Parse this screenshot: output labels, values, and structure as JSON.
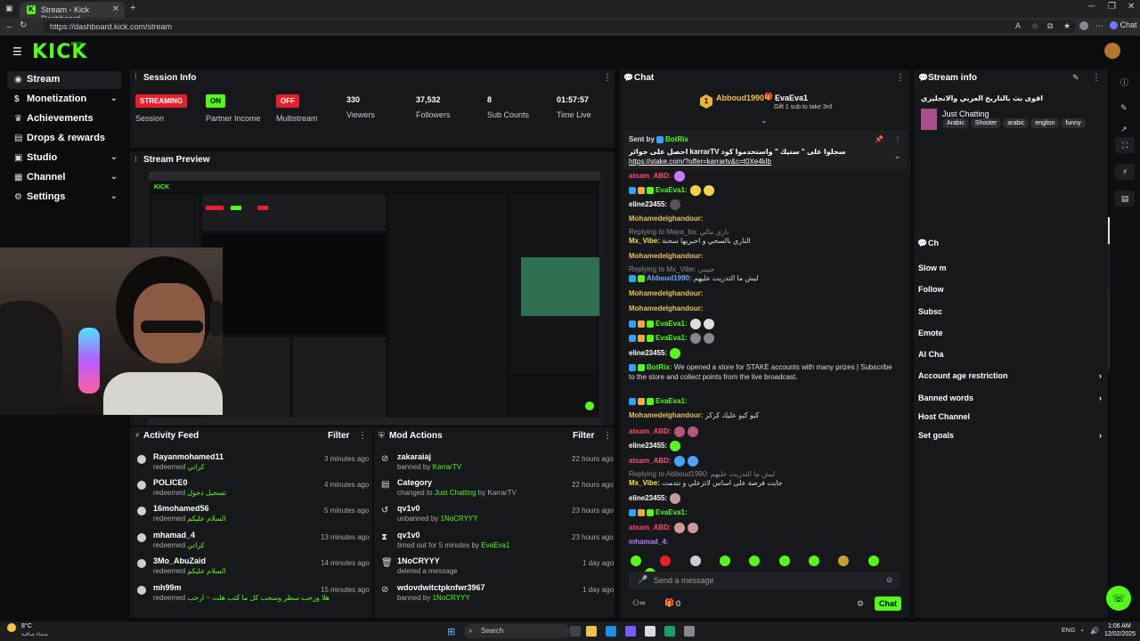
{
  "browser": {
    "tab_title": "Stream - Kick Dashboard",
    "url": "https://dashboard.kick.com/stream",
    "chat_label": "Chat"
  },
  "kick": {
    "logo": "KICK",
    "beta": "BETA"
  },
  "sidebar": {
    "items": [
      {
        "label": "Stream"
      },
      {
        "label": "Monetization"
      },
      {
        "label": "Achievements"
      },
      {
        "label": "Drops & rewards"
      },
      {
        "label": "Studio"
      },
      {
        "label": "Channel"
      },
      {
        "label": "Settings"
      }
    ]
  },
  "session": {
    "title": "Session Info",
    "stats": [
      {
        "value": "STREAMING",
        "label": "Session"
      },
      {
        "value": "ON",
        "label": "Partner Income"
      },
      {
        "value": "OFF",
        "label": "Multistream"
      },
      {
        "value": "330",
        "label": "Viewers"
      },
      {
        "value": "37,532",
        "label": "Followers"
      },
      {
        "value": "8",
        "label": "Sub Counts"
      },
      {
        "value": "01:57:57",
        "label": "Time Live"
      }
    ]
  },
  "preview": {
    "title": "Stream Preview"
  },
  "activity": {
    "title": "Activity Feed",
    "filter": "Filter",
    "rows": [
      {
        "name": "Rayanmohamed11",
        "action": "redeemed",
        "reward": "كراتي",
        "time": "3 minutes ago"
      },
      {
        "name": "POLICE0",
        "action": "redeemed",
        "reward": "تسجيل دخول",
        "time": "4 minutes ago"
      },
      {
        "name": "16mohamed56",
        "action": "redeemed",
        "reward": "السلام عليكم",
        "time": "5 minutes ago"
      },
      {
        "name": "mhamad_4",
        "action": "redeemed",
        "reward": "كراتي",
        "time": "13 minutes ago"
      },
      {
        "name": "3Mo_AbuZaid",
        "action": "redeemed",
        "reward": "السلام عليكم",
        "time": "14 minutes ago"
      },
      {
        "name": "mh99m",
        "action": "redeemed",
        "reward": "هلا ورحب سطر وسحب كل ما كتب هلت ~ ارحب",
        "time": "15 minutes ago"
      }
    ]
  },
  "mod": {
    "title": "Mod Actions",
    "filter": "Filter",
    "rows": [
      {
        "name": "zakaraiaj",
        "desc": "banned by",
        "by": "KarrarTV",
        "time": "22 hours ago"
      },
      {
        "name": "Category",
        "desc": "changed to",
        "by": "Just Chatting",
        "by2": "by KarrarTV",
        "time": "22 hours ago"
      },
      {
        "name": "qv1v0",
        "desc": "unbanned by",
        "by": "1NoCRYYY",
        "time": "23 hours ago"
      },
      {
        "name": "qv1v0",
        "desc": "timed out for 5 minutes by",
        "by": "EvaEva1",
        "time": "23 hours ago"
      },
      {
        "name": "1NoCRYYY",
        "desc": "deleted a message",
        "by": "",
        "time": "1 day ago"
      },
      {
        "name": "wdovdwitctpknfwr3967",
        "desc": "banned by",
        "by": "1NoCRYYY",
        "time": "1 day ago"
      }
    ]
  },
  "chat": {
    "title": "Chat",
    "gift_user1": "Abboud1990",
    "gift_user2": "EvaEva1",
    "gift_count": "1",
    "gift_text": "Gift 1 sub to take 3rd",
    "pinned_by_label": "Sent by",
    "pinned_by": "BotRix",
    "pinned_text": "احصل على جوائز karrarTV سجلوا على \" ستيك \" واستخدموا كود",
    "pinned_link": "https://stake.com/?offer=karrartv&c=t0Xe4klb",
    "lines": [
      {
        "user": "atsam_ABD:",
        "text": "",
        "color": "#ff4d6d"
      },
      {
        "user": "EvaEva1:",
        "text": "",
        "color": "#53fc18"
      },
      {
        "user": "eline23455:",
        "text": "",
        "color": "#ffffff"
      },
      {
        "user": "Mohamedelghandour:",
        "text": "",
        "color": "#e8c35a"
      },
      {
        "user": "",
        "text": "Replying to Maya_ba: ناري مالي",
        "color": "#888"
      },
      {
        "user": "Mx_Vibe:",
        "text": "الناري بالسحي و اخبريها سخنة",
        "color": "#f2e14a"
      },
      {
        "user": "Mohamedelghandour:",
        "text": "",
        "color": "#e8c35a"
      },
      {
        "user": "",
        "text": "Replying to Mx_Vibe: حبيبي",
        "color": "#888"
      },
      {
        "user": "Abboud1990:",
        "text": "ليش ما التدزيت عليهم",
        "color": "#6aa8ff"
      },
      {
        "user": "Mohamedelghandour:",
        "text": "",
        "color": "#e8c35a"
      },
      {
        "user": "Mohamedelghandour:",
        "text": "",
        "color": "#e8c35a"
      },
      {
        "user": "EvaEva1:",
        "text": "",
        "color": "#53fc18"
      },
      {
        "user": "EvaEva1:",
        "text": "",
        "color": "#53fc18"
      },
      {
        "user": "eline23455:",
        "text": "",
        "color": "#ffffff"
      },
      {
        "user": "BotRix:",
        "text": "We opened a store for STAKE accounts with many prizes | Subscribe to the store and collect points",
        "text2": "from the live broadcast.",
        "color": "#53fc18"
      },
      {
        "user": "EvaEva1:",
        "text": "",
        "color": "#53fc18"
      },
      {
        "user": "Mohamedelghandour:",
        "text": "كيو كيو عليك كركر",
        "color": "#e8c35a"
      },
      {
        "user": "atsam_ABD:",
        "text": "",
        "color": "#ff4d6d"
      },
      {
        "user": "eline23455:",
        "text": "",
        "color": "#ffffff"
      },
      {
        "user": "atsam_ABD:",
        "text": "",
        "color": "#ff4d6d"
      },
      {
        "user": "",
        "text": "Replying to Abboud1990: ليش ما التدزيت عليهم",
        "color": "#888"
      },
      {
        "user": "Mx_Vibe:",
        "text": "جايت فرصة على اساس لاتزعلي و تندمت",
        "color": "#f2e14a"
      },
      {
        "user": "eline23455:",
        "text": "",
        "color": "#ffffff"
      },
      {
        "user": "EvaEva1:",
        "text": "",
        "color": "#53fc18"
      },
      {
        "user": "atsam_ABD:",
        "text": "",
        "color": "#ff4d6d"
      },
      {
        "user": "mhamad_4:",
        "text": "",
        "color": "#b07cff"
      }
    ],
    "input_placeholder": "Send a message",
    "gift_counter": "0",
    "send_label": "Chat"
  },
  "streaminfo": {
    "title": "Stream info",
    "stream_title": "اقوى بث بالتاريخ العربي والانجليزي",
    "category": "Just Chatting",
    "tags": [
      "Arabic",
      "Shooter",
      "arabic",
      "englisn",
      "funny"
    ],
    "settings_title": "Ch",
    "partial_items": [
      "Slow m",
      "Follow",
      "Subsc",
      "Emote",
      "AI Cha"
    ],
    "items": [
      {
        "label": "Account age restriction",
        "chev": true
      },
      {
        "label": "Banned words",
        "chev": true
      },
      {
        "label": "Host Channel",
        "chev": false
      },
      {
        "label": "Set goals",
        "chev": true
      }
    ]
  },
  "taskbar": {
    "weather_temp": "8°C",
    "weather_desc": "سماء صافية",
    "search": "Search",
    "lang": "ENG",
    "time": "1:06 AM",
    "date": "12/02/2025"
  }
}
